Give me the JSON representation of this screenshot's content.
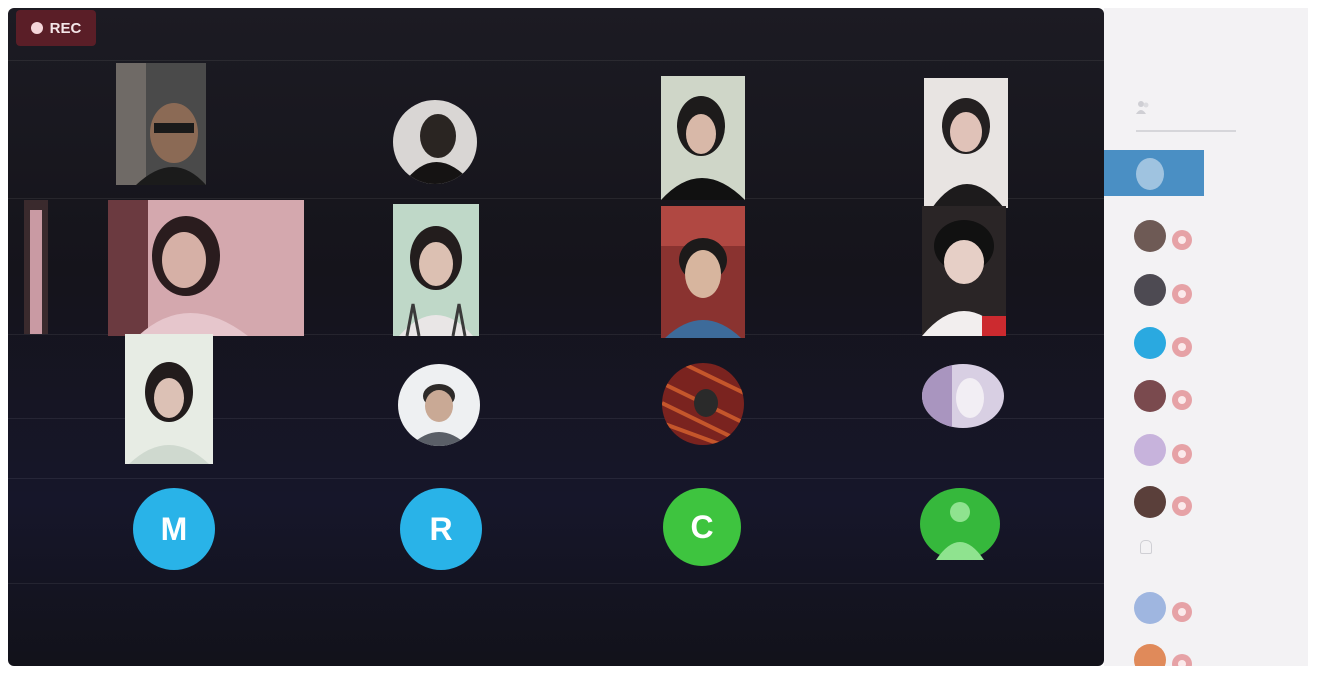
{
  "meeting": {
    "recording": {
      "label": "REC",
      "icon": "record-dot-icon"
    }
  },
  "grid": {
    "avatar_letters": [
      "M",
      "R",
      "C"
    ],
    "colors": {
      "blue": "#29b3e8",
      "green": "#3ec43f"
    }
  },
  "sidebar": {
    "title": "",
    "tab_label": "",
    "selected_participant": "",
    "participants": [
      {
        "name": ""
      },
      {
        "name": ""
      },
      {
        "name": ""
      },
      {
        "name": ""
      },
      {
        "name": ""
      },
      {
        "name": ""
      },
      {
        "name": ""
      },
      {
        "name": ""
      }
    ],
    "colors": {
      "badge": "#e6a2a6",
      "selected": "#4a8fc4"
    }
  }
}
